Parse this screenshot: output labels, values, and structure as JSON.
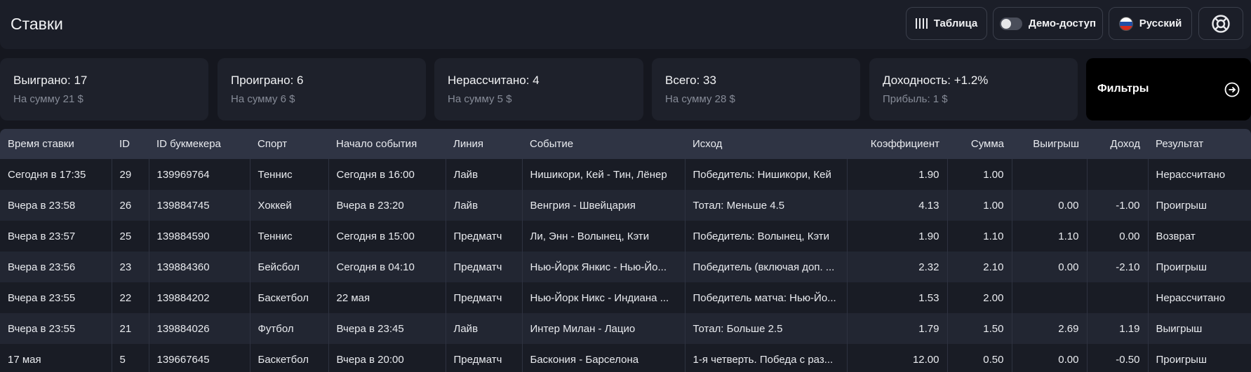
{
  "header": {
    "title": "Ставки",
    "table_button": "Таблица",
    "demo_label": "Демо-доступ",
    "language": "Русский",
    "help_icon": "lifebuoy-icon"
  },
  "stats": [
    {
      "title": "Выиграно: 17",
      "sub": "На сумму 21 $"
    },
    {
      "title": "Проиграно: 6",
      "sub": "На сумму 6 $"
    },
    {
      "title": "Нерассчитано: 4",
      "sub": "На сумму 5 $"
    },
    {
      "title": "Всего: 33",
      "sub": "На сумму 28 $"
    },
    {
      "title": "Доходность: +1.2%",
      "sub": "Прибыль: 1 $"
    }
  ],
  "filters": {
    "label": "Фильтры",
    "icon": "arrow-right-circle-icon"
  },
  "table": {
    "columns": [
      "Время ставки",
      "ID",
      "ID букмекера",
      "Спорт",
      "Начало события",
      "Линия",
      "Событие",
      "Исход",
      "Коэффициент",
      "Сумма",
      "Выигрыш",
      "Доход",
      "Результат"
    ],
    "rows": [
      [
        "Сегодня в 17:35",
        "29",
        "139969764",
        "Теннис",
        "Сегодня в 16:00",
        "Лайв",
        "Нишикори, Кей - Тин, Лёнер",
        "Победитель: Нишикори, Кей",
        "1.90",
        "1.00",
        "",
        "",
        "Нерассчитано"
      ],
      [
        "Вчера в 23:58",
        "26",
        "139884745",
        "Хоккей",
        "Вчера в 23:20",
        "Лайв",
        "Венгрия - Швейцария",
        "Тотал: Меньше 4.5",
        "4.13",
        "1.00",
        "0.00",
        "-1.00",
        "Проигрыш"
      ],
      [
        "Вчера в 23:57",
        "25",
        "139884590",
        "Теннис",
        "Сегодня в 15:00",
        "Предматч",
        "Ли, Энн - Волынец, Кэти",
        "Победитель: Волынец, Кэти",
        "1.90",
        "1.10",
        "1.10",
        "0.00",
        "Возврат"
      ],
      [
        "Вчера в 23:56",
        "23",
        "139884360",
        "Бейсбол",
        "Сегодня в 04:10",
        "Предматч",
        "Нью-Йорк Янкис - Нью-Йо...",
        "Победитель (включая доп. ...",
        "2.32",
        "2.10",
        "0.00",
        "-2.10",
        "Проигрыш"
      ],
      [
        "Вчера в 23:55",
        "22",
        "139884202",
        "Баскетбол",
        "22 мая",
        "Предматч",
        "Нью-Йорк Никс - Индиана ...",
        "Победитель матча: Нью-Йо...",
        "1.53",
        "2.00",
        "",
        "",
        "Нерассчитано"
      ],
      [
        "Вчера в 23:55",
        "21",
        "139884026",
        "Футбол",
        "Вчера в 23:45",
        "Лайв",
        "Интер Милан - Лацио",
        "Тотал: Больше 2.5",
        "1.79",
        "1.50",
        "2.69",
        "1.19",
        "Выигрыш"
      ],
      [
        "17 мая",
        "5",
        "139667645",
        "Баскетбол",
        "Вчера в 20:00",
        "Предматч",
        "Баскония - Барселона",
        "1-я четверть. Победа с раз...",
        "12.00",
        "0.50",
        "0.00",
        "-0.50",
        "Проигрыш"
      ]
    ]
  },
  "colors": {
    "background": "#15171f",
    "card": "#1e212b",
    "header_row": "#2f3444",
    "filters": "#000000"
  }
}
